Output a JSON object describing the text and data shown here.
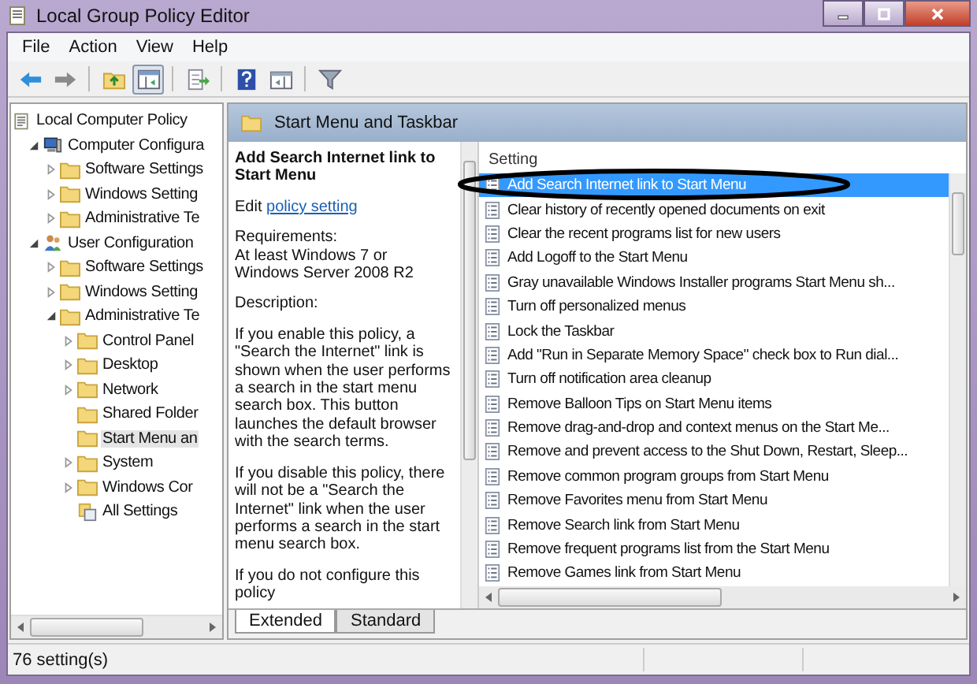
{
  "window": {
    "title": "Local Group Policy Editor"
  },
  "menu": [
    "File",
    "Action",
    "View",
    "Help"
  ],
  "toolbar": [
    {
      "kind": "back",
      "pressed": false
    },
    {
      "kind": "forward",
      "pressed": false
    },
    {
      "kind": "up",
      "pressed": false
    },
    {
      "kind": "tree",
      "pressed": true
    },
    {
      "kind": "export",
      "pressed": false
    },
    {
      "kind": "help",
      "pressed": false
    },
    {
      "kind": "pane",
      "pressed": false
    },
    {
      "kind": "filter",
      "pressed": false
    }
  ],
  "tree": [
    {
      "label": "Local Computer Policy",
      "kind": "policy",
      "selected": false,
      "children": [
        {
          "label": "Computer Configura",
          "kind": "computer",
          "expanded": true,
          "selected": false,
          "children": [
            {
              "label": "Software Settings",
              "kind": "folder",
              "expanded": false,
              "selected": false
            },
            {
              "label": "Windows Setting",
              "kind": "folder",
              "expanded": false,
              "selected": false
            },
            {
              "label": "Administrative Te",
              "kind": "folder",
              "expanded": false,
              "selected": false
            }
          ]
        },
        {
          "label": "User Configuration",
          "kind": "user",
          "expanded": true,
          "selected": false,
          "children": [
            {
              "label": "Software Settings",
              "kind": "folder",
              "expanded": false,
              "selected": false
            },
            {
              "label": "Windows Setting",
              "kind": "folder",
              "expanded": false,
              "selected": false
            },
            {
              "label": "Administrative Te",
              "kind": "folder",
              "expanded": true,
              "selected": false,
              "children": [
                {
                  "label": "Control Panel",
                  "kind": "folder",
                  "expanded": false,
                  "selected": false
                },
                {
                  "label": "Desktop",
                  "kind": "folder",
                  "expanded": false,
                  "selected": false
                },
                {
                  "label": "Network",
                  "kind": "folder",
                  "expanded": false,
                  "selected": false
                },
                {
                  "label": "Shared Folder",
                  "kind": "folder",
                  "selected": false
                },
                {
                  "label": "Start Menu an",
                  "kind": "folder",
                  "selected": true
                },
                {
                  "label": "System",
                  "kind": "folder",
                  "expanded": false,
                  "selected": false
                },
                {
                  "label": "Windows Cor",
                  "kind": "folder",
                  "expanded": false,
                  "selected": false
                },
                {
                  "label": "All Settings",
                  "kind": "all",
                  "selected": false
                }
              ]
            }
          ]
        }
      ]
    }
  ],
  "header": {
    "title": "Start Menu and Taskbar"
  },
  "description": {
    "title": "Add Search Internet link to Start Menu",
    "edit_prefix": "Edit",
    "edit_link": "policy setting",
    "requirements_label": "Requirements:",
    "requirements": "At least Windows 7 or Windows Server 2008 R2",
    "description_label": "Description:",
    "paragraphs": [
      "If you enable this policy, a \"Search the Internet\" link is shown when the user performs a search in the start menu search box.  This button launches the default browser with the search terms.",
      "If you disable this policy, there will not be a \"Search the Internet\" link when the user performs a search in the start menu search box.",
      "If you do not configure this policy"
    ]
  },
  "tabs": [
    {
      "label": "Extended",
      "selected": true
    },
    {
      "label": "Standard",
      "selected": false
    }
  ],
  "settings": {
    "column": "Setting",
    "rows": [
      {
        "name": "Add Search Internet link to Start Menu",
        "selected": true
      },
      {
        "name": "Clear history of recently opened documents on exit",
        "selected": false
      },
      {
        "name": "Clear the recent programs list for new users",
        "selected": false
      },
      {
        "name": "Add Logoff to the Start Menu",
        "selected": false
      },
      {
        "name": "Gray unavailable Windows Installer programs Start Menu sh...",
        "selected": false
      },
      {
        "name": "Turn off personalized menus",
        "selected": false
      },
      {
        "name": "Lock the Taskbar",
        "selected": false
      },
      {
        "name": "Add \"Run in Separate Memory Space\" check box to Run dial...",
        "selected": false
      },
      {
        "name": "Turn off notification area cleanup",
        "selected": false
      },
      {
        "name": "Remove Balloon Tips on Start Menu items",
        "selected": false
      },
      {
        "name": "Remove drag-and-drop and context menus on the Start Me...",
        "selected": false
      },
      {
        "name": "Remove and prevent access to the Shut Down, Restart, Sleep...",
        "selected": false
      },
      {
        "name": "Remove common program groups from Start Menu",
        "selected": false
      },
      {
        "name": "Remove Favorites menu from Start Menu",
        "selected": false
      },
      {
        "name": "Remove Search link from Start Menu",
        "selected": false
      },
      {
        "name": "Remove frequent programs list from the Start Menu",
        "selected": false
      },
      {
        "name": "Remove Games link from Start Menu",
        "selected": false
      }
    ]
  },
  "status_bar": {
    "text": "76 setting(s)"
  }
}
